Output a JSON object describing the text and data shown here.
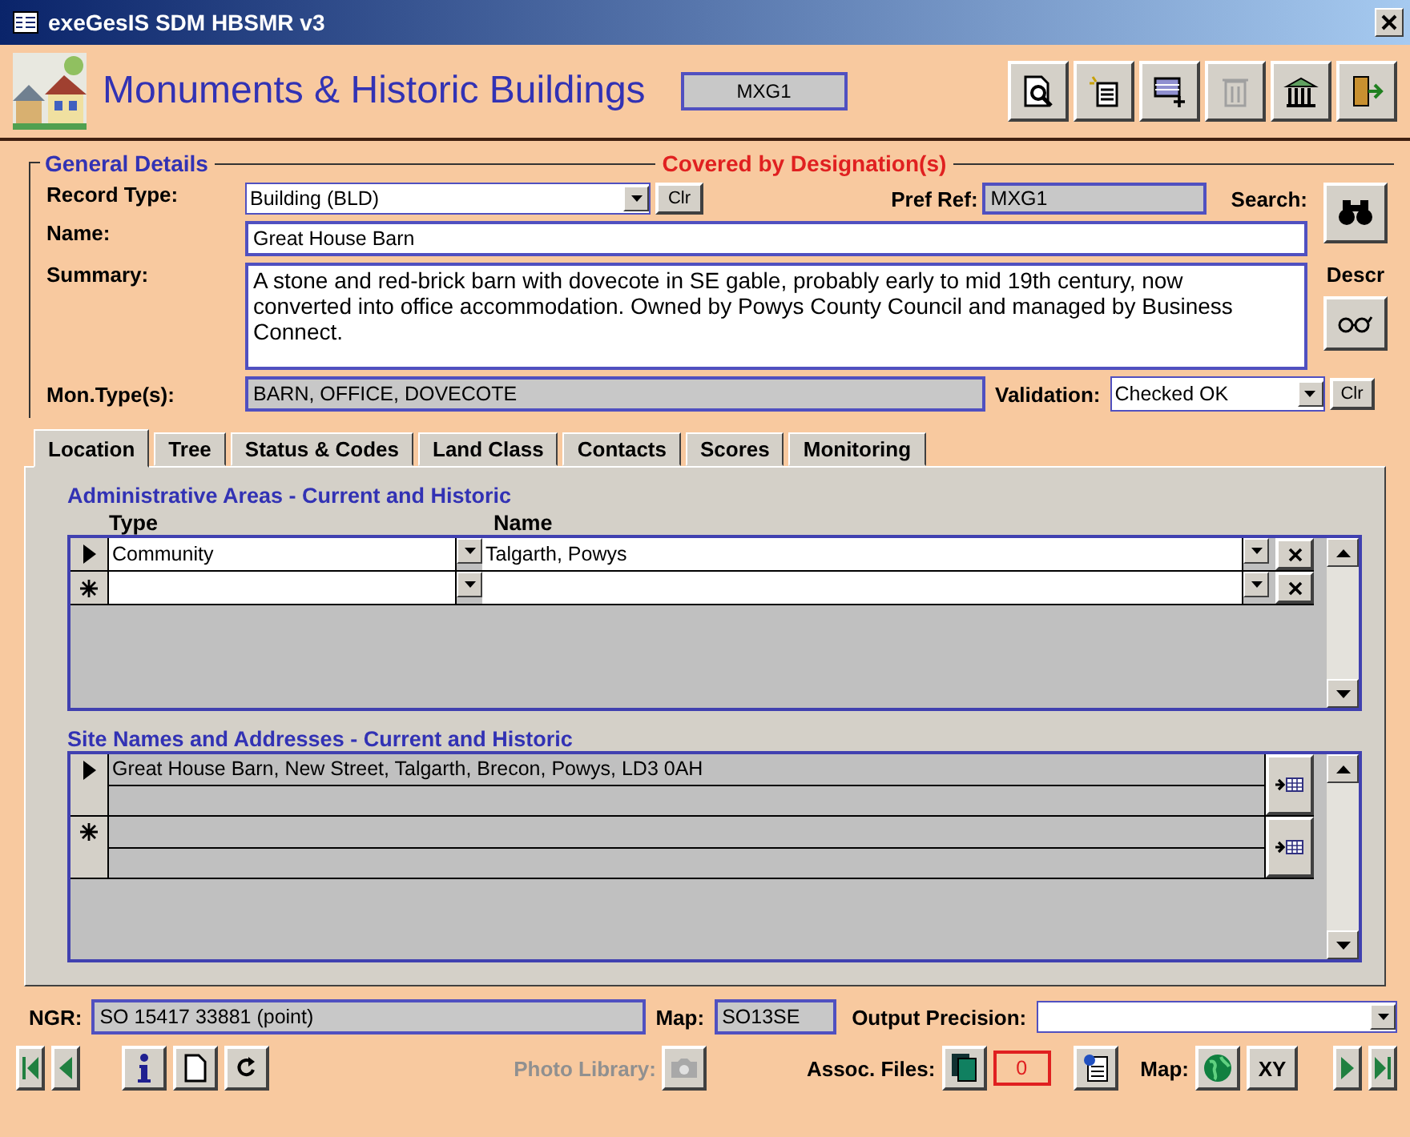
{
  "window": {
    "title": "exeGesIS SDM HBSMR v3"
  },
  "header": {
    "title": "Monuments & Historic Buildings",
    "record_ref": "MXG1"
  },
  "toolbar": [
    {
      "kind": "preview",
      "disabled": false
    },
    {
      "kind": "list",
      "disabled": false
    },
    {
      "kind": "add",
      "disabled": false
    },
    {
      "kind": "delete",
      "disabled": true
    },
    {
      "kind": "building",
      "disabled": false
    },
    {
      "kind": "exit",
      "disabled": false
    }
  ],
  "general": {
    "title": "General Details",
    "designation": "Covered by Designation(s)",
    "record_type": {
      "label": "Record Type:",
      "value": "Building (BLD)",
      "clear": "Clr"
    },
    "pref_ref": {
      "label": "Pref Ref:",
      "value": "MXG1"
    },
    "search": {
      "label": "Search:"
    },
    "name": {
      "label": "Name:",
      "value": "Great House Barn"
    },
    "summary": {
      "label": "Summary:",
      "value": "A stone and red-brick barn with dovecote in SE gable, probably early to mid 19th century, now converted into office accommodation. Owned by Powys County Council and managed by Business Connect."
    },
    "descr": {
      "label": "Descr"
    },
    "mon_types": {
      "label": "Mon.Type(s):",
      "value": "BARN, OFFICE, DOVECOTE"
    },
    "validation": {
      "label": "Validation:",
      "value": "Checked OK",
      "clear": "Clr"
    }
  },
  "tabs": [
    {
      "label": "Location",
      "selected": true
    },
    {
      "label": "Tree",
      "selected": false
    },
    {
      "label": "Status & Codes",
      "selected": false
    },
    {
      "label": "Land Class",
      "selected": false
    },
    {
      "label": "Contacts",
      "selected": false
    },
    {
      "label": "Scores",
      "selected": false
    },
    {
      "label": "Monitoring",
      "selected": false
    }
  ],
  "admin_areas": {
    "title": "Administrative Areas - Current and Historic",
    "columns": [
      "Type",
      "Name"
    ],
    "rows": [
      {
        "kind": "current",
        "type": "Community",
        "name": "Talgarth, Powys"
      },
      {
        "kind": "new"
      }
    ]
  },
  "site_names": {
    "title": "Site Names and Addresses - Current and Historic",
    "rows": [
      {
        "kind": "current",
        "address": "Great House Barn, New Street, Talgarth, Brecon, Powys, LD3 0AH"
      },
      {
        "kind": "new"
      }
    ]
  },
  "footer": {
    "ngr": {
      "label": "NGR:",
      "value": "SO 15417 33881  (point)"
    },
    "map": {
      "label": "Map:",
      "value": "SO13SE"
    },
    "output_precision": {
      "label": "Output Precision:"
    }
  },
  "nav": {
    "photo_library": {
      "label": "Photo Library:",
      "disabled": true
    },
    "assoc_files": {
      "label": "Assoc. Files:",
      "count": "0"
    },
    "map": {
      "label": "Map:",
      "xy": "XY"
    }
  }
}
